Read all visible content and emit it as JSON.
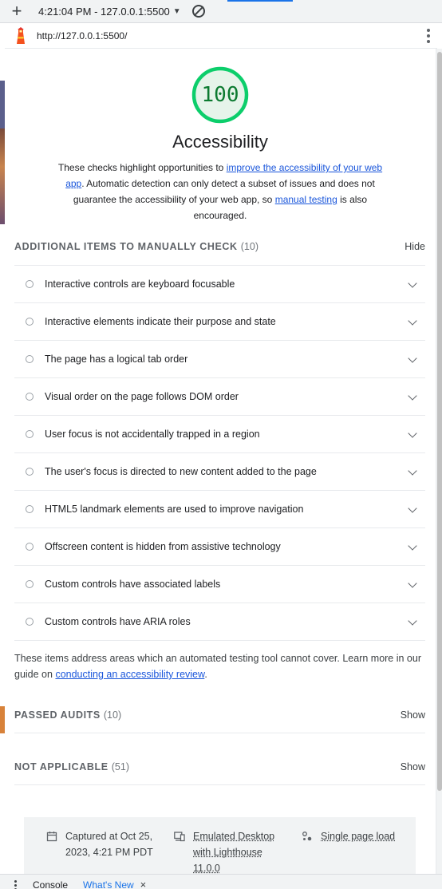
{
  "toolbar": {
    "report_label": "4:21:04 PM - 127.0.0.1:5500",
    "icons": [
      "plus-icon",
      "dropdown-caret-icon",
      "clear-icon"
    ]
  },
  "urlbar": {
    "url": "http://127.0.0.1:5500/"
  },
  "category": {
    "score": "100",
    "title": "Accessibility",
    "gauge_color": "#0cce6b",
    "score_color": "#0c7a30",
    "desc_pre": "These checks highlight opportunities to ",
    "desc_link1": "improve the accessibility of your web app",
    "desc_mid": ". Automatic detection can only detect a subset of issues and does not guarantee the accessibility of your web app, so ",
    "desc_link2": "manual testing",
    "desc_post": " is also encouraged."
  },
  "manual": {
    "title": "ADDITIONAL ITEMS TO MANUALLY CHECK",
    "count": "(10)",
    "toggle": "Hide",
    "items": [
      "Interactive controls are keyboard focusable",
      "Interactive elements indicate their purpose and state",
      "The page has a logical tab order",
      "Visual order on the page follows DOM order",
      "User focus is not accidentally trapped in a region",
      "The user's focus is directed to new content added to the page",
      "HTML5 landmark elements are used to improve navigation",
      "Offscreen content is hidden from assistive technology",
      "Custom controls have associated labels",
      "Custom controls have ARIA roles"
    ],
    "footnote_pre": "These items address areas which an automated testing tool cannot cover. Learn more in our guide on ",
    "footnote_link": "conducting an accessibility review",
    "footnote_post": "."
  },
  "passed": {
    "title": "PASSED AUDITS",
    "count": "(10)",
    "toggle": "Show"
  },
  "not_applicable": {
    "title": "NOT APPLICABLE",
    "count": "(51)",
    "toggle": "Show"
  },
  "meta": {
    "captured": "Captured at Oct 25, 2023, 4:21 PM PDT",
    "emulated": "Emulated Desktop with Lighthouse 11.0.0",
    "load": "Single page load"
  },
  "drawer": {
    "console_tab": "Console",
    "whatsnew_tab": "What's New",
    "close": "×"
  }
}
